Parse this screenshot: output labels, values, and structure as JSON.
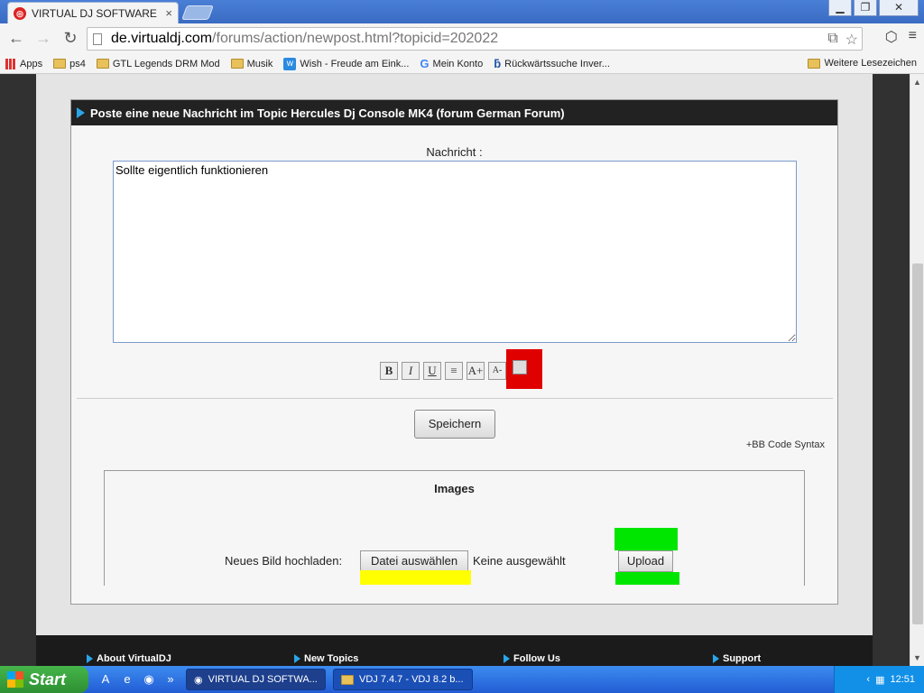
{
  "browser": {
    "tab_title": "VIRTUAL DJ SOFTWARE - Ne",
    "tab_close": "×",
    "url_host": "de.virtualdj.com",
    "url_path": "/forums/action/newpost.html?topicid=202022"
  },
  "bookmarks": {
    "items": [
      "Apps",
      "ps4",
      "GTL Legends DRM Mod",
      "Musik",
      "Wish - Freude am Eink...",
      "Mein Konto",
      "Rückwärtssuche Inver..."
    ],
    "other": "Weitere Lesezeichen"
  },
  "page": {
    "panel_title": "Poste eine neue Nachricht im Topic Hercules Dj Console MK4 (forum German Forum)",
    "message_label": "Nachricht :",
    "message_value": "Sollte eigentlich funktionieren",
    "format_buttons": [
      "B",
      "I",
      "U",
      "≡",
      "A+",
      "A-"
    ],
    "save_label": "Speichern",
    "bbcode": "+BB Code Syntax",
    "images_title": "Images",
    "upload_label": "Neues Bild hochladen:",
    "choose_file": "Datei auswählen",
    "no_file": "Keine ausgewählt",
    "upload_button": "Upload"
  },
  "footer": [
    "About VirtualDJ",
    "New Topics",
    "Follow Us",
    "Support"
  ],
  "taskbar": {
    "start": "Start",
    "tasks": [
      "VIRTUAL DJ SOFTWA...",
      "VDJ 7.4.7 - VDJ 8.2 b..."
    ],
    "clock": "12:51"
  },
  "colors": {
    "accent": "#2aa5e8",
    "highlight_red": "#e00000",
    "highlight_yellow": "#ffff00",
    "highlight_green": "#00e600"
  }
}
